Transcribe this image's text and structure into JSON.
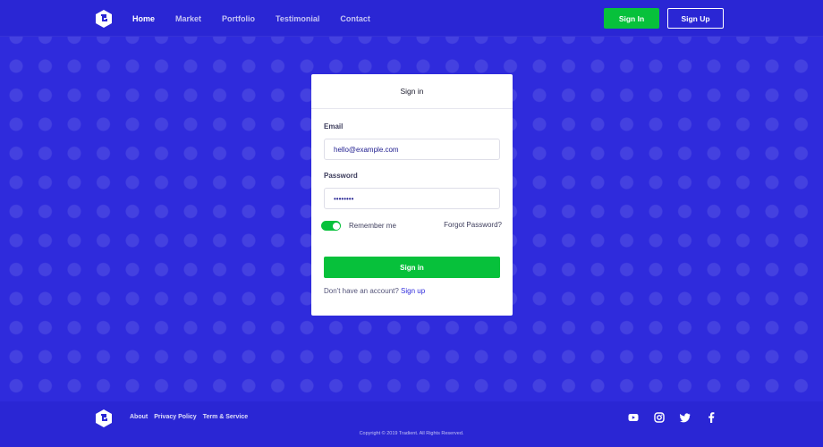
{
  "header": {
    "nav": [
      {
        "label": "Home",
        "active": true
      },
      {
        "label": "Market",
        "active": false
      },
      {
        "label": "Portfolio",
        "active": false
      },
      {
        "label": "Testimonial",
        "active": false
      },
      {
        "label": "Contact",
        "active": false
      }
    ],
    "signin_label": "Sign In",
    "signup_label": "Sign Up"
  },
  "card": {
    "title": "Sign in",
    "email_label": "Email",
    "email_value": "hello@example.com",
    "password_label": "Password",
    "password_value": "password",
    "remember_label": "Remember me",
    "remember_checked": true,
    "forgot_label": "Forgot Password?",
    "submit_label": "Sign in",
    "account_prompt": "Don't have an account?",
    "signup_link": "Sign up"
  },
  "footer": {
    "links": [
      "About",
      "Privacy Policy",
      "Term & Service"
    ],
    "social": [
      "youtube-icon",
      "instagram-icon",
      "twitter-icon",
      "facebook-icon"
    ],
    "copyright": "Copyright © 2019 Tradient. All Rights Reserved."
  },
  "colors": {
    "primary": "#2f2bdc",
    "accent_green": "#07c13b",
    "white": "#ffffff"
  }
}
